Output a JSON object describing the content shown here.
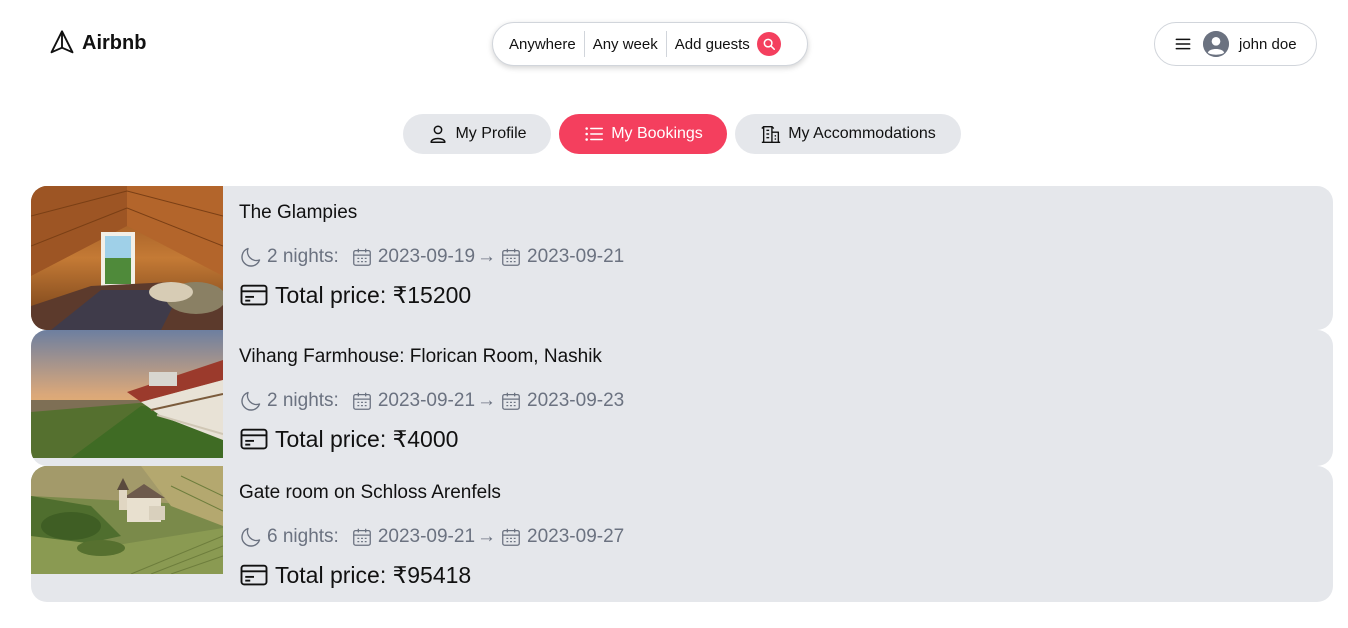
{
  "header": {
    "brand": "Airbnb",
    "search": {
      "anywhere": "Anywhere",
      "any_week": "Any week",
      "add_guests": "Add guests"
    },
    "user": {
      "name": "john doe"
    }
  },
  "tabs": [
    {
      "label": "My Profile",
      "active": false,
      "icon": "user-icon"
    },
    {
      "label": "My Bookings",
      "active": true,
      "icon": "list-icon"
    },
    {
      "label": "My Accommodations",
      "active": false,
      "icon": "building-icon"
    }
  ],
  "bookings": [
    {
      "title": "The Glampies",
      "nights": "2 nights:",
      "check_in": "2023-09-19",
      "arrow": "→",
      "check_out": "2023-09-21",
      "price": "Total price: ₹15200"
    },
    {
      "title": "Vihang Farmhouse: Florican Room, Nashik",
      "nights": "2 nights:",
      "check_in": "2023-09-21",
      "arrow": "→",
      "check_out": "2023-09-23",
      "price": "Total price: ₹4000"
    },
    {
      "title": "Gate room on Schloss Arenfels",
      "nights": "6 nights:",
      "check_in": "2023-09-21",
      "arrow": "→",
      "check_out": "2023-09-27",
      "price": "Total price: ₹95418"
    }
  ],
  "colors": {
    "primary": "#f43f5e",
    "card_bg": "#e5e7eb",
    "muted_text": "#6b7280"
  }
}
